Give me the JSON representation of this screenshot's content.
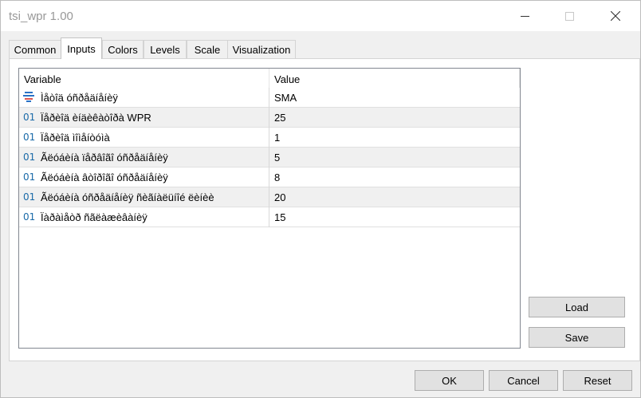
{
  "window": {
    "title": "tsi_wpr 1.00"
  },
  "tabs": [
    {
      "label": "Common"
    },
    {
      "label": "Inputs"
    },
    {
      "label": "Colors"
    },
    {
      "label": "Levels"
    },
    {
      "label": "Scale"
    },
    {
      "label": "Visualization"
    }
  ],
  "active_tab": "Inputs",
  "grid": {
    "headers": {
      "variable": "Variable",
      "value": "Value"
    },
    "rows": [
      {
        "icon": "enum-icon",
        "name": "Ìåòîä óñðåäíåíèÿ",
        "value": "SMA"
      },
      {
        "icon": "int-icon",
        "name": "Ïåðèîä èíäèêàòîðà WPR",
        "value": "25"
      },
      {
        "icon": "int-icon",
        "name": "Ïåðèîä ìîìåíòóìà",
        "value": "1"
      },
      {
        "icon": "int-icon",
        "name": "Ãëóáèíà ïåðâîãî óñðåäíåíèÿ",
        "value": "5"
      },
      {
        "icon": "int-icon",
        "name": "Ãëóáèíà âòîðîãî óñðåäíåíèÿ",
        "value": "8"
      },
      {
        "icon": "int-icon",
        "name": "Ãëóáèíà óñðåäíåíèÿ ñèãíàëüíîé ëèíèè",
        "value": "20"
      },
      {
        "icon": "int-icon",
        "name": "Ïàðàìåòð ñãëàæèâàíèÿ",
        "value": "15"
      }
    ],
    "int_icon_text": "01"
  },
  "side_buttons": {
    "load": "Load",
    "save": "Save"
  },
  "footer_buttons": {
    "ok": "OK",
    "cancel": "Cancel",
    "reset": "Reset"
  }
}
